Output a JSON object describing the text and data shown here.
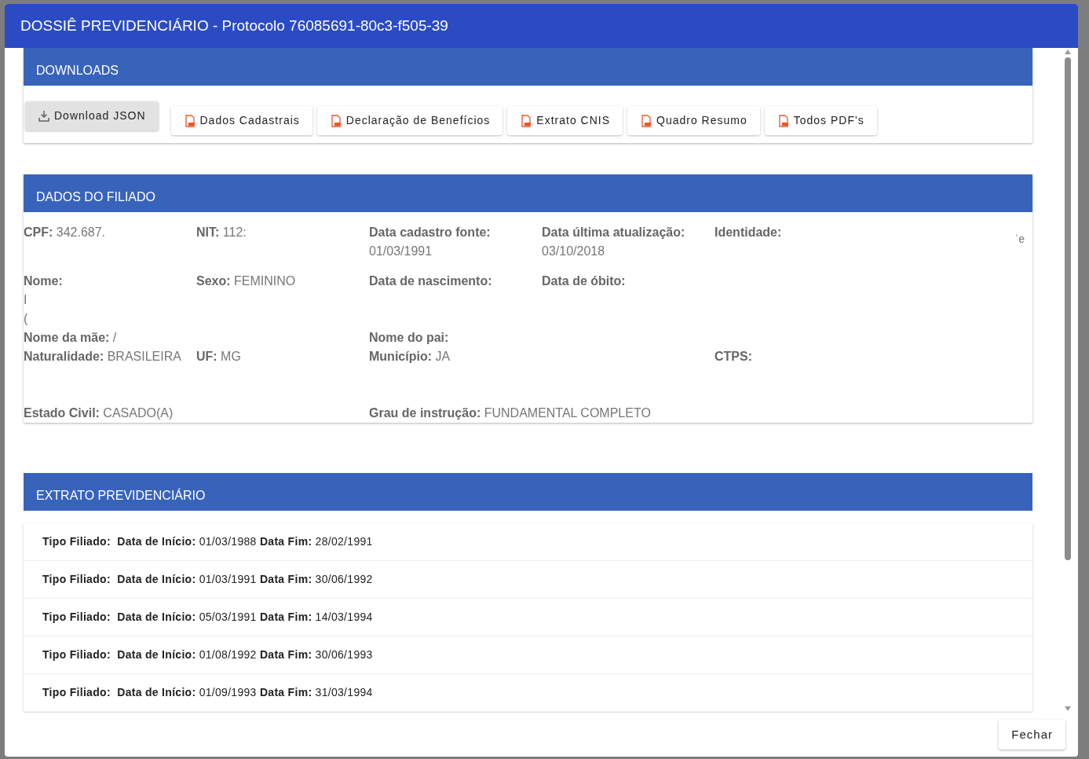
{
  "dialog": {
    "title": "DOSSIÊ PREVIDENCIÁRIO - Protocolo 76085691-80c3-f505-39"
  },
  "downloads": {
    "title": "DOWNLOADS",
    "buttons": [
      {
        "label": "Download JSON",
        "kind": "download"
      },
      {
        "label": "Dados Cadastrais",
        "kind": "pdf"
      },
      {
        "label": "Declaração de Benefícios",
        "kind": "pdf"
      },
      {
        "label": "Extrato CNIS",
        "kind": "pdf"
      },
      {
        "label": "Quadro Resumo",
        "kind": "pdf"
      },
      {
        "label": "Todos PDF's",
        "kind": "pdf"
      }
    ]
  },
  "filiado": {
    "title": "DADOS DO FILIADO",
    "rows": [
      {
        "fields": [
          {
            "label": "CPF:",
            "value": "342.687.",
            "kind": "inline"
          },
          {
            "label": "NIT:",
            "value": "112:",
            "kind": "inline"
          },
          {
            "label": "Data cadastro fonte:",
            "value": "01/03/1991",
            "kind": "stacked"
          },
          {
            "label": "Data última atualização:",
            "value": "03/10/2018",
            "kind": "stacked"
          },
          {
            "label": "Identidade:",
            "kind": "inline"
          }
        ],
        "trailing": "ˈe"
      },
      {
        "fields": [
          {
            "label": "Nome:",
            "lines": [
              "I",
              "("
            ],
            "kind": "stacked"
          },
          {
            "label": "Sexo:",
            "value": "FEMININO",
            "kind": "inline"
          },
          {
            "label": "Data de nascimento:",
            "kind": "inline"
          },
          {
            "label": "Data de óbito:",
            "kind": "inline"
          }
        ]
      },
      {
        "fields": [
          {
            "label": "Nome da mãe:",
            "value": "/",
            "kind": "inline"
          },
          {
            "label": "Nome do pai:",
            "kind": "inline"
          }
        ]
      },
      {
        "fields": [
          {
            "label": "Naturalidade:",
            "value": "BRASILEIRA",
            "kind": "inline"
          },
          {
            "label": "UF:",
            "value": "MG",
            "kind": "inline"
          },
          {
            "label": "Município:",
            "value": "JA",
            "kind": "inline"
          },
          {
            "label": "CTPS:",
            "kind": "inline"
          }
        ]
      },
      {
        "fields": [
          {
            "label": "Estado Civil:",
            "value": "CASADO(A)",
            "kind": "inline"
          },
          {
            "label": "Grau de instrução:",
            "value": "FUNDAMENTAL COMPLETO",
            "kind": "inline"
          }
        ]
      }
    ]
  },
  "extrato": {
    "title": "EXTRATO PREVIDENCIÁRIO",
    "rows": [
      {
        "tipo_label": "Tipo Filiado:",
        "inicio_label": "Data de Início:",
        "inicio": "01/03/1988",
        "fim_label": "Data Fim:",
        "fim": "28/02/1991"
      },
      {
        "tipo_label": "Tipo Filiado:",
        "inicio_label": "Data de Início:",
        "inicio": "01/03/1991",
        "fim_label": "Data Fim:",
        "fim": "30/06/1992"
      },
      {
        "tipo_label": "Tipo Filiado:",
        "inicio_label": "Data de Início:",
        "inicio": "05/03/1991",
        "fim_label": "Data Fim:",
        "fim": "14/03/1994"
      },
      {
        "tipo_label": "Tipo Filiado:",
        "inicio_label": "Data de Início:",
        "inicio": "01/08/1992",
        "fim_label": "Data Fim:",
        "fim": "30/06/1993"
      },
      {
        "tipo_label": "Tipo Filiado:",
        "inicio_label": "Data de Início:",
        "inicio": "01/09/1993",
        "fim_label": "Data Fim:",
        "fim": "31/03/1994"
      }
    ]
  },
  "footer": {
    "close_button": "Fechar"
  }
}
